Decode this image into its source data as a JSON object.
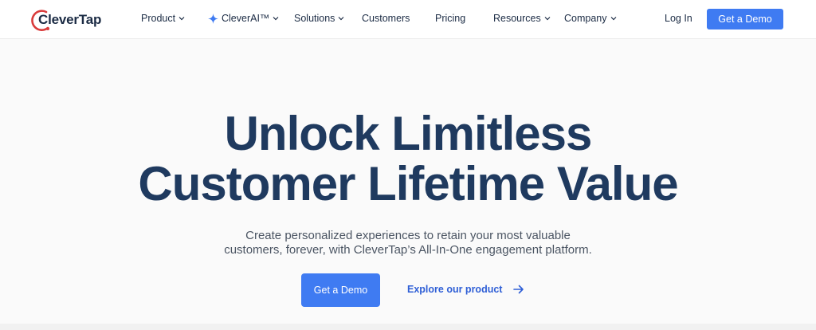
{
  "brand": {
    "name": "CleverTap",
    "accent": "#d93b3b"
  },
  "nav": {
    "items": [
      {
        "label": "Product",
        "dropdown": true
      },
      {
        "label": "CleverAI™",
        "dropdown": true,
        "icon": "sparkle-icon"
      },
      {
        "label": "Solutions",
        "dropdown": true
      },
      {
        "label": "Customers",
        "dropdown": false
      },
      {
        "label": "Pricing",
        "dropdown": false
      },
      {
        "label": "Resources",
        "dropdown": true
      },
      {
        "label": "Company",
        "dropdown": true
      }
    ],
    "login_label": "Log In",
    "demo_label": "Get a Demo"
  },
  "hero": {
    "headline_line1": "Unlock Limitless",
    "headline_line2": "Customer Lifetime Value",
    "sub_line1": "Create personalized experiences to retain your most valuable",
    "sub_line2": "customers, forever, with CleverTap’s All-In-One engagement platform.",
    "cta_primary": "Get a Demo",
    "cta_secondary": "Explore our product"
  },
  "colors": {
    "primary_button": "#3f7bf2",
    "headline": "#1f3a5f",
    "link": "#2f5fd6"
  }
}
